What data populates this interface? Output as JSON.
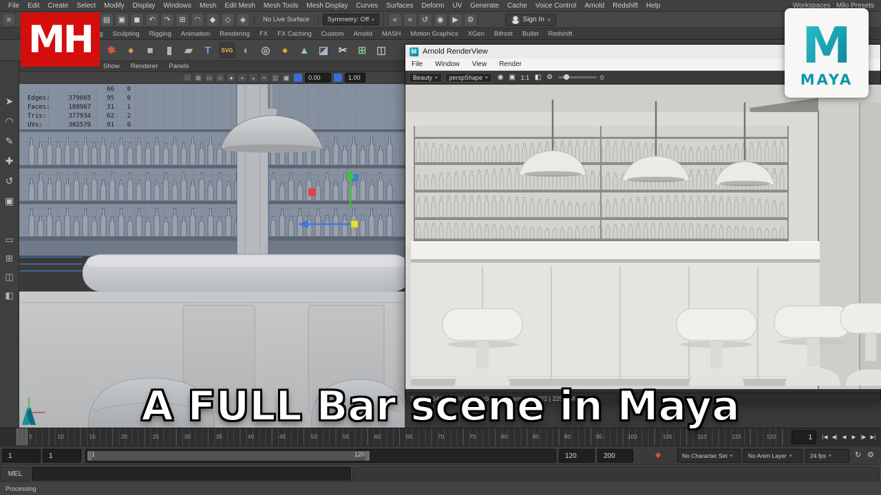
{
  "overlay": {
    "title": "A FULL Bar scene in Maya",
    "mh_logo": "MH",
    "maya_logo_letter": "M",
    "maya_logo_word": "MAYA",
    "brand_red": "#d40d0d",
    "brand_teal": "#0e98ac"
  },
  "menubar": {
    "items": [
      "File",
      "Edit",
      "Create",
      "Select",
      "Modify",
      "Display",
      "Windows",
      "Mesh",
      "Edit Mesh",
      "Mesh Tools",
      "Mesh Display",
      "Curves",
      "Surfaces",
      "Deform",
      "UV",
      "Generate",
      "Cache",
      "Voice Control",
      "Arnold",
      "Redshift",
      "Help"
    ],
    "workspace": "Workspaces : Milo Presets"
  },
  "toolbar": {
    "menu_icon": {
      "name": "workspace-menu-icon",
      "glyph": "≡"
    },
    "icons_left": [
      {
        "name": "file-new-icon",
        "glyph": "▤"
      },
      {
        "name": "file-open-icon",
        "glyph": "▣"
      },
      {
        "name": "file-save-icon",
        "glyph": "◼"
      },
      {
        "name": "undo-icon",
        "glyph": "↶"
      },
      {
        "name": "redo-icon",
        "glyph": "↷"
      },
      {
        "name": "snap-grid-icon",
        "glyph": "⊞"
      },
      {
        "name": "snap-curve-icon",
        "glyph": "◠"
      },
      {
        "name": "snap-point-icon",
        "glyph": "◆"
      },
      {
        "name": "snap-projected-icon",
        "glyph": "◇"
      },
      {
        "name": "make-live-icon",
        "glyph": "◈"
      }
    ],
    "live_surface": "No Live Surface",
    "symmetry": "Symmetry: Off",
    "icons_right": [
      {
        "name": "input-connections-icon",
        "glyph": "«"
      },
      {
        "name": "output-connections-icon",
        "glyph": "»"
      },
      {
        "name": "construction-history-icon",
        "glyph": "↺"
      },
      {
        "name": "render-current-frame-icon",
        "glyph": "◉"
      },
      {
        "name": "ipr-render-icon",
        "glyph": "▶"
      },
      {
        "name": "render-settings-icon",
        "glyph": "⚙"
      }
    ],
    "sign_in": "Sign In"
  },
  "shelf": {
    "tabs": [
      "Modeling",
      "Sculpting",
      "Rigging",
      "Animation",
      "Rendering",
      "FX",
      "FX Caching",
      "Custom",
      "Arnold",
      "MASH",
      "Motion Graphics",
      "XGen",
      "Bifrost",
      "Bullet",
      "Redshift"
    ],
    "icons": [
      {
        "name": "nurbs-curves-icon",
        "glyph": "✱",
        "color": "#d4593f"
      },
      {
        "name": "poly-sphere-icon",
        "glyph": "●",
        "color": "#de9a4a"
      },
      {
        "name": "poly-cube-icon",
        "glyph": "■",
        "color": "#aeb6bf"
      },
      {
        "name": "poly-cylinder-icon",
        "glyph": "▮",
        "color": "#aeb6bf"
      },
      {
        "name": "poly-plane-icon",
        "glyph": "▰",
        "color": "#aeb6bf"
      },
      {
        "name": "type-tool-icon",
        "glyph": "T",
        "color": "#58a6e8"
      },
      {
        "name": "svg-tool-icon",
        "glyph": "SVG",
        "color": "#e6c04f"
      },
      {
        "name": "boolean-icon",
        "glyph": "◐",
        "color": "#79aede"
      },
      {
        "name": "combine-icon",
        "glyph": "◎",
        "color": "#a8bac9"
      },
      {
        "name": "smooth-icon",
        "glyph": "●",
        "color": "#e2a23f"
      },
      {
        "name": "extrude-icon",
        "glyph": "▲",
        "color": "#8fc3d8"
      },
      {
        "name": "bevel-icon",
        "glyph": "◪",
        "color": "#a8bac9"
      },
      {
        "name": "multi-cut-icon",
        "glyph": "✂",
        "color": "#cfd8de"
      },
      {
        "name": "quad-draw-icon",
        "glyph": "⊞",
        "color": "#7cba7c"
      },
      {
        "name": "mirror-icon",
        "glyph": "◫",
        "color": "#a8bac9"
      }
    ]
  },
  "panel_menu": {
    "items": [
      "Show",
      "Renderer",
      "Panels"
    ]
  },
  "viewport": {
    "toolbar_icons": [
      {
        "name": "select-camera-icon",
        "glyph": "□"
      },
      {
        "name": "grid-toggle-icon",
        "glyph": "⊞"
      },
      {
        "name": "film-gate-icon",
        "glyph": "▭"
      },
      {
        "name": "wireframe-icon",
        "glyph": "◇"
      },
      {
        "name": "shaded-icon",
        "glyph": "●"
      },
      {
        "name": "shadows-icon",
        "glyph": "◗"
      },
      {
        "name": "ao-icon",
        "glyph": "◒"
      },
      {
        "name": "antialias-icon",
        "glyph": "≈"
      },
      {
        "name": "xray-icon",
        "glyph": "◫"
      },
      {
        "name": "isolate-icon",
        "glyph": "▦"
      }
    ],
    "field_translate": "0.00",
    "field_scale": "1.00",
    "hud": {
      "rows": [
        {
          "label": "",
          "total": "",
          "sel": "66",
          "comp": "0"
        },
        {
          "label": "Edges:",
          "total": "379665",
          "sel": "95",
          "comp": "0"
        },
        {
          "label": "Faces:",
          "total": "188967",
          "sel": "31",
          "comp": "1"
        },
        {
          "label": "Tris:",
          "total": "377934",
          "sel": "62",
          "comp": "2"
        },
        {
          "label": "UVs:",
          "total": "302579",
          "sel": "91",
          "comp": "0"
        }
      ]
    }
  },
  "toolbox": {
    "tools": [
      {
        "name": "select-tool-icon",
        "glyph": "➤"
      },
      {
        "name": "lasso-tool-icon",
        "glyph": "◠"
      },
      {
        "name": "paint-select-tool-icon",
        "glyph": "✎"
      },
      {
        "name": "move-tool-icon",
        "glyph": "✚"
      },
      {
        "name": "rotate-tool-icon",
        "glyph": "↺"
      },
      {
        "name": "scale-tool-icon",
        "glyph": "▣"
      }
    ],
    "layouts": [
      {
        "name": "layout-single-pane-icon",
        "glyph": "▭"
      },
      {
        "name": "layout-four-pane-icon",
        "glyph": "⊞"
      },
      {
        "name": "layout-two-pane-icon",
        "glyph": "◫"
      },
      {
        "name": "layout-outliner-icon",
        "glyph": "◧"
      }
    ]
  },
  "arnold": {
    "window_title": "Arnold RenderView",
    "menus": [
      "File",
      "Window",
      "View",
      "Render"
    ],
    "aov": "Beauty",
    "camera": "perspShape",
    "icons_a": [
      {
        "name": "start-ipr-icon",
        "glyph": "◉"
      },
      {
        "name": "render-region-icon",
        "glyph": "▣"
      }
    ],
    "ratio": "1:1",
    "icons_b": [
      {
        "name": "ab-compare-icon",
        "glyph": "◧"
      },
      {
        "name": "display-settings-icon",
        "glyph": "⚙"
      }
    ],
    "gain": "0",
    "status": "3 | 960x540 (100%) | perspShape | Samples 2/2/2 | 225.3 MB"
  },
  "timeline": {
    "labels": [
      "5",
      "10",
      "15",
      "20",
      "25",
      "30",
      "35",
      "40",
      "45",
      "50",
      "55",
      "60",
      "65",
      "70",
      "75",
      "80",
      "85",
      "90",
      "95",
      "100",
      "105",
      "110",
      "115",
      "120"
    ],
    "current_frame": "1",
    "playback": [
      {
        "name": "go-to-start-button",
        "glyph": "|◀"
      },
      {
        "name": "step-back-button",
        "glyph": "◀|"
      },
      {
        "name": "play-backwards-button",
        "glyph": "◀"
      },
      {
        "name": "play-forwards-button",
        "glyph": "▶"
      },
      {
        "name": "step-forward-button",
        "glyph": "|▶"
      },
      {
        "name": "go-to-end-button",
        "glyph": "▶|"
      }
    ],
    "range": {
      "start": "1",
      "start_inner": "1",
      "slider_start_label": "1",
      "slider_end_label": "120",
      "end_inner": "120",
      "end": "200"
    },
    "auto_key_icon": {
      "name": "auto-keyframe-icon",
      "glyph": "◆"
    },
    "character_set": "No Character Set",
    "anim_layer": "No Anim Layer",
    "fps": "24 fps"
  },
  "command_line": {
    "label": "MEL"
  },
  "statusbar": {
    "text": "Processing"
  }
}
